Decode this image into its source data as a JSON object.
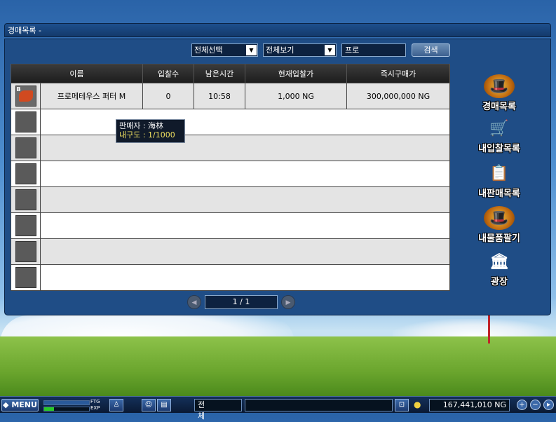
{
  "window": {
    "title": "경매목록 -"
  },
  "filters": {
    "category_select": "전체선택",
    "view_select": "전체보기",
    "search_value": "프로",
    "search_button": "검색"
  },
  "table": {
    "headers": {
      "name": "이름",
      "bids": "입찰수",
      "remaining": "남은시간",
      "current_bid": "현재입찰가",
      "buy_now": "즉시구매가"
    },
    "rows": [
      {
        "badge": "B",
        "name": "프로메테우스 퍼터 M",
        "bids": "0",
        "remaining": "10:58",
        "current_bid": "1,000 NG",
        "buy_now": "300,000,000 NG"
      }
    ]
  },
  "tooltip": {
    "seller_line": "판매자 : 海林",
    "durability_line": "내구도 : 1/1000"
  },
  "pager": {
    "text": "1 / 1"
  },
  "side_menu": [
    {
      "label": "경매목록",
      "icon": "auction-hat-icon"
    },
    {
      "label": "내입찰목록",
      "icon": "shopping-cart-icon"
    },
    {
      "label": "내판매목록",
      "icon": "clipboard-icon"
    },
    {
      "label": "내물품팔기",
      "icon": "sell-item-icon"
    },
    {
      "label": "광장",
      "icon": "plaza-building-icon"
    }
  ],
  "bottom_bar": {
    "menu_label": "MENU",
    "ftg_label": "FTG",
    "exp_label": "EXP",
    "chat_channel": "전체",
    "money": "167,441,010 NG"
  },
  "colors": {
    "name_text": "#2a2ac8",
    "buy_now_text": "#c020c0",
    "ftg_bar": "#2a5a9a",
    "exp_bar": "#28c828"
  }
}
